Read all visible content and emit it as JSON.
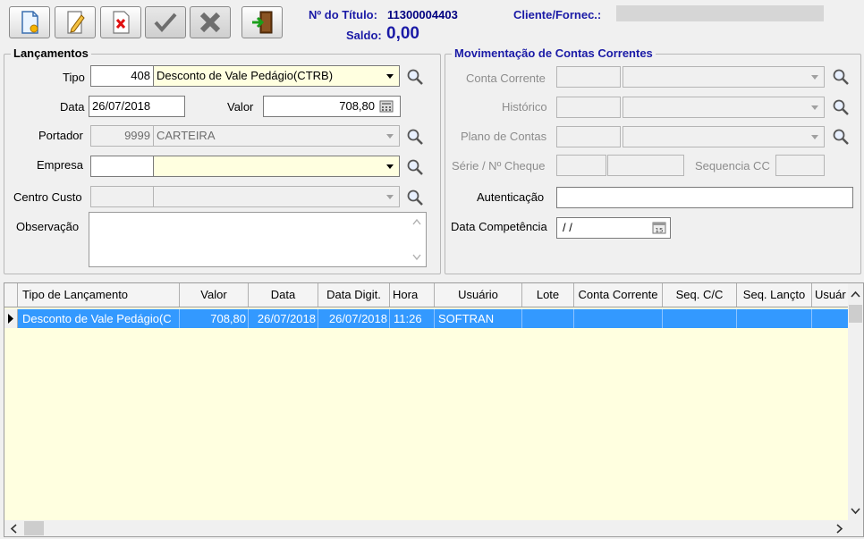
{
  "toolbar": {
    "buttons": [
      {
        "name": "new-document-icon",
        "enabled": true
      },
      {
        "name": "edit-pencil-icon",
        "enabled": true
      },
      {
        "name": "delete-document-icon",
        "enabled": true
      },
      {
        "name": "confirm-check-icon",
        "enabled": false
      },
      {
        "name": "cancel-x-icon",
        "enabled": false
      },
      {
        "name": "exit-door-icon",
        "enabled": true
      }
    ]
  },
  "header": {
    "titulo_label": "Nº do Título:",
    "titulo_value": "11300004403",
    "saldo_label": "Saldo:",
    "saldo_value": "0,00",
    "cliente_label": "Cliente/Fornec.:",
    "cliente_value": ""
  },
  "lancamentos": {
    "title": "Lançamentos",
    "tipo_label": "Tipo",
    "tipo_code": "408",
    "tipo_desc": "Desconto de Vale Pedágio(CTRB)",
    "data_label": "Data",
    "data_value": "26/07/2018",
    "valor_label": "Valor",
    "valor_value": "708,80",
    "portador_label": "Portador",
    "portador_code": "9999",
    "portador_desc": "CARTEIRA",
    "empresa_label": "Empresa",
    "empresa_code": "",
    "empresa_desc": "",
    "centro_custo_label": "Centro Custo",
    "centro_custo_code": "",
    "centro_custo_desc": "",
    "observacao_label": "Observação",
    "observacao_value": ""
  },
  "movimentacao": {
    "title": "Movimentação de Contas Correntes",
    "conta_corrente_label": "Conta Corrente",
    "historico_label": "Histórico",
    "plano_contas_label": "Plano de Contas",
    "serie_cheque_label": "Série / Nº Cheque",
    "sequencia_cc_label": "Sequencia CC",
    "autenticacao_label": "Autenticação",
    "autenticacao_value": "",
    "data_competencia_label": "Data Competência",
    "data_competencia_value": " / /"
  },
  "grid": {
    "columns": [
      "Tipo de Lançamento",
      "Valor",
      "Data",
      "Data Digit.",
      "Hora",
      "Usuário",
      "Lote",
      "Conta Corrente",
      "Seq. C/C",
      "Seq. Lançto",
      "Usuár"
    ],
    "rows": [
      [
        "Desconto de Vale Pedágio(C",
        "708,80",
        "26/07/2018",
        "26/07/2018",
        "11:26",
        "SOFTRAN",
        "",
        "",
        "",
        "",
        ""
      ]
    ]
  },
  "colors": {
    "accent": "#1a1aa6",
    "selection": "#3399ff",
    "yellow_field": "#ffffe0"
  }
}
